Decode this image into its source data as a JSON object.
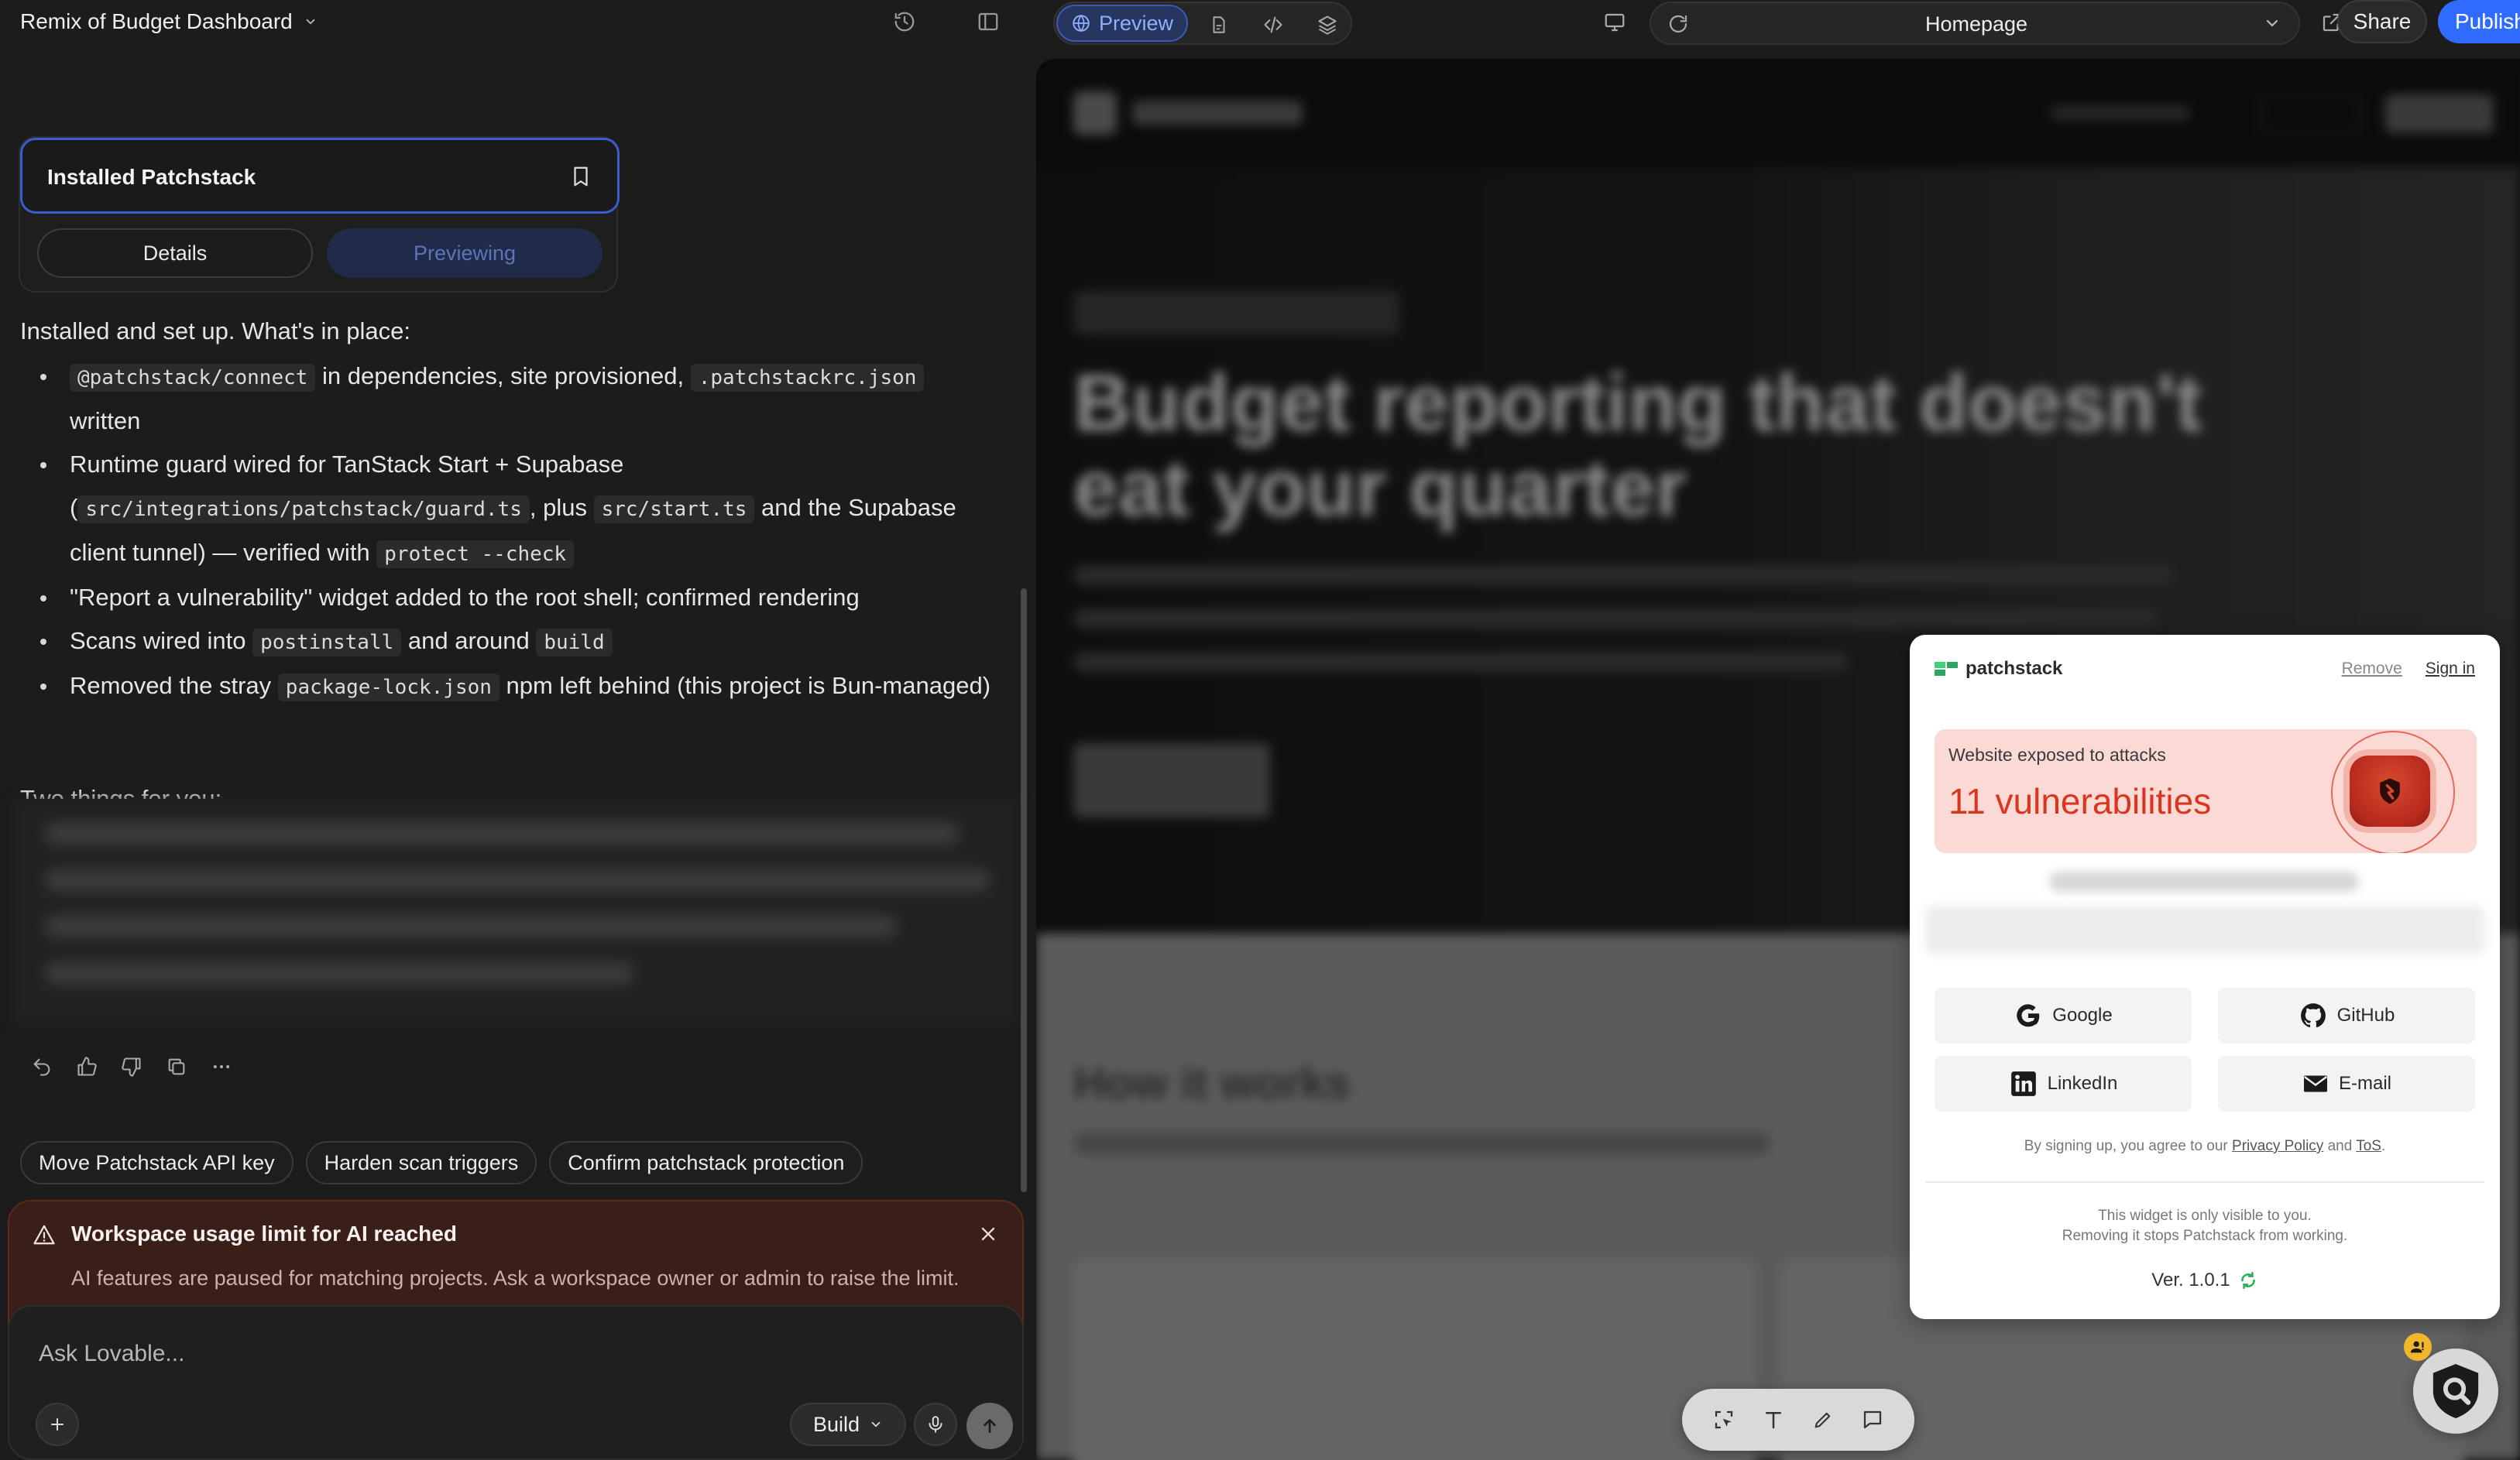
{
  "project": {
    "title": "Remix of Budget Dashboard"
  },
  "install_card": {
    "title": "Installed Patchstack",
    "details_label": "Details",
    "previewing_label": "Previewing"
  },
  "message": {
    "intro": "Installed and set up. What's in place:",
    "items": [
      {
        "parts": [
          {
            "code": "@patchstack/connect"
          },
          {
            "text": " in dependencies, site provisioned, "
          },
          {
            "code": ".patchstackrc.json"
          },
          {
            "text": " written"
          }
        ]
      },
      {
        "parts": [
          {
            "text": "Runtime guard wired for TanStack Start + Supabase ("
          },
          {
            "code": "src/integrations/patchstack/guard.ts"
          },
          {
            "text": ", plus "
          },
          {
            "code": "src/start.ts"
          },
          {
            "text": " and the Supabase client tunnel) — verified with "
          },
          {
            "code": "protect --check"
          }
        ]
      },
      {
        "parts": [
          {
            "text": "\"Report a vulnerability\" widget added to the root shell; confirmed rendering"
          }
        ]
      },
      {
        "parts": [
          {
            "text": "Scans wired into "
          },
          {
            "code": "postinstall"
          },
          {
            "text": " and around "
          },
          {
            "code": "build"
          }
        ]
      },
      {
        "parts": [
          {
            "text": "Removed the stray "
          },
          {
            "code": "package-lock.json"
          },
          {
            "text": " npm left behind (this project is Bun-managed)"
          }
        ]
      }
    ],
    "two_things": "Two things for you:"
  },
  "suggestions": [
    "Move Patchstack API key",
    "Harden scan triggers",
    "Confirm patchstack protection"
  ],
  "limit_banner": {
    "title": "Workspace usage limit for AI reached",
    "body": "AI features are paused for matching projects. Ask a workspace owner or admin to raise the limit."
  },
  "composer": {
    "placeholder": "Ask Lovable...",
    "mode_label": "Build"
  },
  "topbar": {
    "preview_label": "Preview",
    "page": "Homepage",
    "share_label": "Share",
    "publish_label": "Publish"
  },
  "preview_site": {
    "headline": "Budget reporting that doesn't eat your quarter",
    "how_heading": "How it works"
  },
  "patchstack": {
    "brand": "patchstack",
    "remove_label": "Remove",
    "signin_label": "Sign in",
    "alert_title": "Website exposed to attacks",
    "alert_value": "11 vulnerabilities",
    "buttons": [
      "Google",
      "GitHub",
      "LinkedIn",
      "E-mail"
    ],
    "terms_prefix": "By signing up, you agree to our ",
    "privacy_label": "Privacy Policy",
    "and_label": " and ",
    "tos_label": "ToS",
    "note_line1": "This widget is only visible to you.",
    "note_line2": "Removing it stops Patchstack from working.",
    "version": "Ver. 1.0.1"
  },
  "colors": {
    "accent": "#2f6bff",
    "alert_red": "#d9361f",
    "banner_bg": "#3a1f18"
  }
}
